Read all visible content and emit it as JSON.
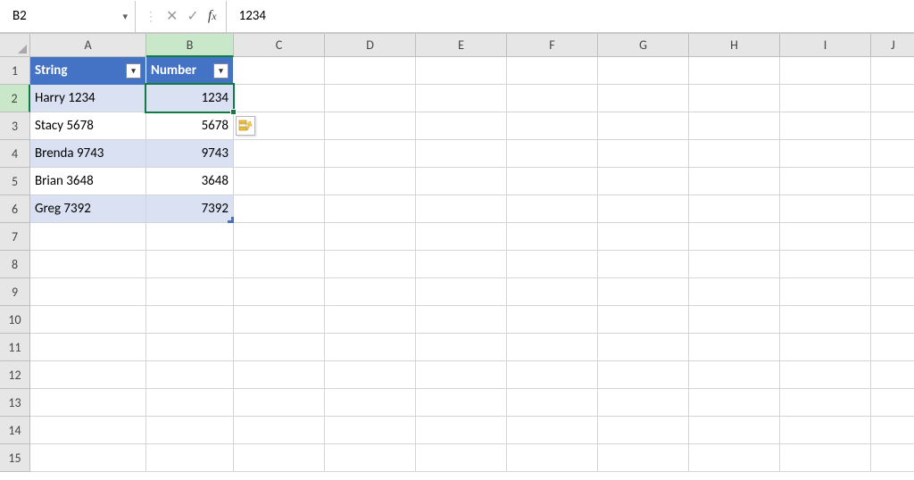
{
  "formula_bar": {
    "name_box": "B2",
    "formula": "1234"
  },
  "columns": [
    "A",
    "B",
    "C",
    "D",
    "E",
    "F",
    "G",
    "H",
    "I",
    "J"
  ],
  "selected_column": "B",
  "rows_visible": 15,
  "selected_row": 2,
  "table": {
    "headers": {
      "a": "String",
      "b": "Number"
    },
    "rows": [
      {
        "a": "Harry 1234",
        "b": "1234"
      },
      {
        "a": "Stacy 5678",
        "b": "5678"
      },
      {
        "a": "Brenda 9743",
        "b": "9743"
      },
      {
        "a": "Brian 3648",
        "b": "3648"
      },
      {
        "a": "Greg 7392",
        "b": "7392"
      }
    ]
  },
  "active_cell": "B2"
}
